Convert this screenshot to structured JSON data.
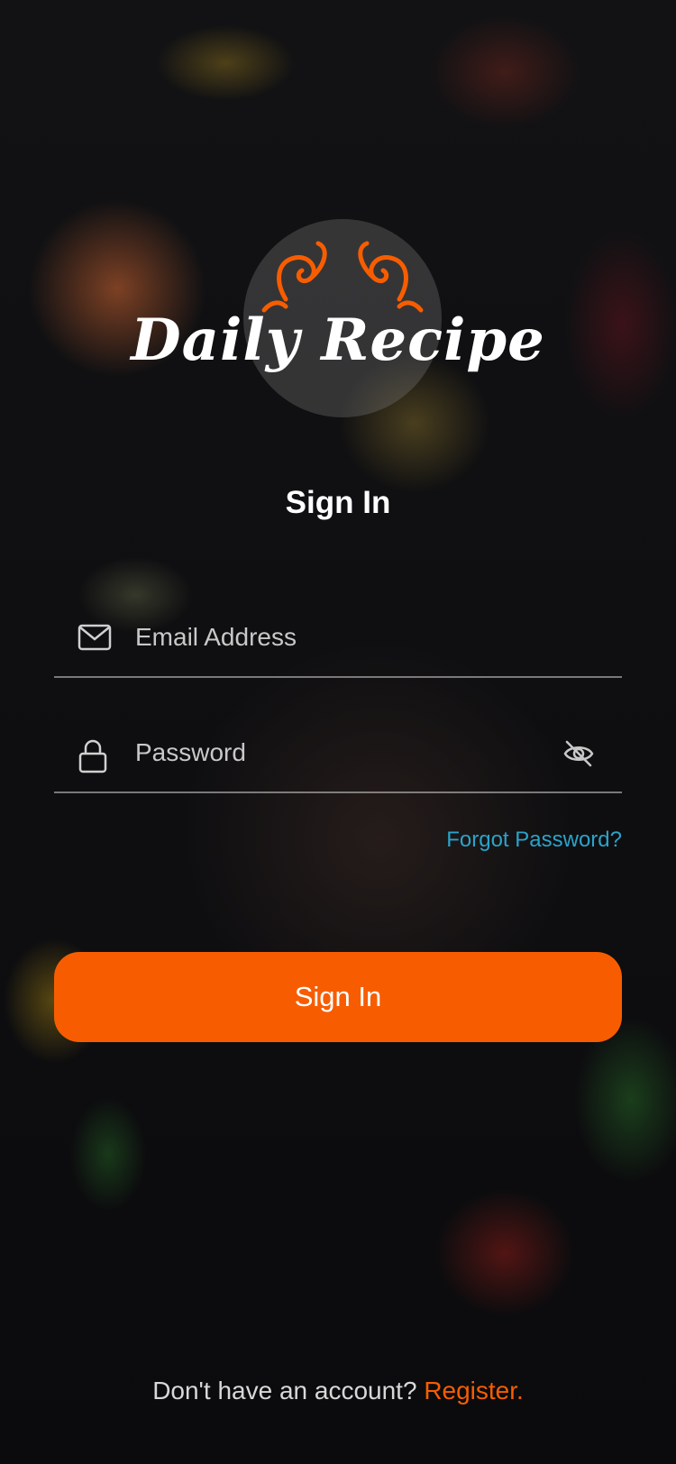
{
  "app": {
    "brand_name": "Daily Recipe",
    "accent_color": "#f75d00",
    "link_color": "#2ba3c9"
  },
  "form": {
    "heading": "Sign In",
    "email": {
      "value": "",
      "placeholder": "Email Address",
      "icon": "mail-icon"
    },
    "password": {
      "value": "",
      "placeholder": "Password",
      "icon": "lock-icon",
      "toggle_icon": "eye-off-icon"
    },
    "forgot_password_label": "Forgot Password?",
    "submit_label": "Sign In"
  },
  "footer": {
    "prompt": "Don't have an account?",
    "register_label": "Register."
  }
}
